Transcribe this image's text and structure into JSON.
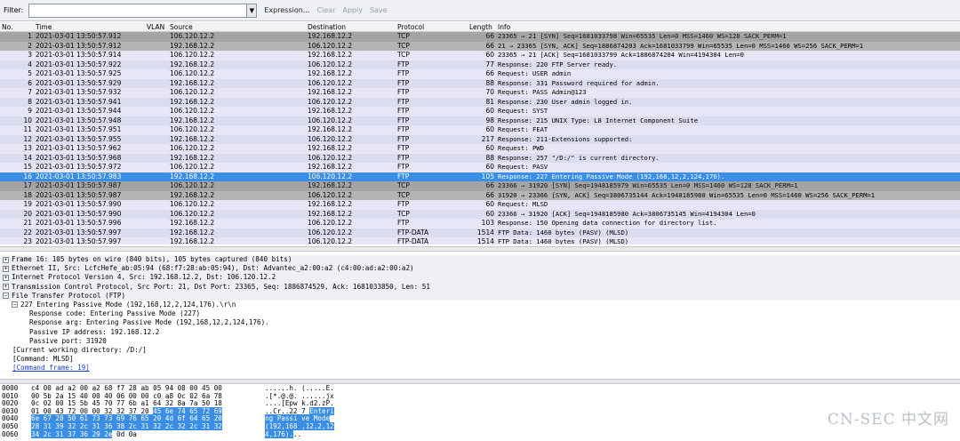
{
  "filter_bar": {
    "label": "Filter:",
    "value": "",
    "expression": "Expression...",
    "clear": "Clear",
    "apply": "Apply",
    "save": "Save"
  },
  "packet_list": {
    "columns": [
      "No.",
      "Time",
      "VLAN",
      "Source",
      "Destination",
      "Protocol",
      "Length",
      "Info"
    ],
    "rows": [
      {
        "no": "1",
        "time": "2021-03-01 13:50:57.912",
        "src": "106.120.12.2",
        "dst": "192.168.12.2",
        "proto": "TCP",
        "len": "66",
        "info": "23365 → 21 [SYN] Seq=1681033798 Win=65535 Len=0 MSS=1460 WS=128 SACK_PERM=1",
        "style": "tcp"
      },
      {
        "no": "2",
        "time": "2021-03-01 13:50:57.912",
        "src": "192.168.12.2",
        "dst": "106.120.12.2",
        "proto": "TCP",
        "len": "66",
        "info": "21 → 23365 [SYN, ACK] Seq=1886874203 Ack=1681033799 Win=65535 Len=0 MSS=1460 WS=256 SACK_PERM=1",
        "style": "tcp"
      },
      {
        "no": "3",
        "time": "2021-03-01 13:50:57.914",
        "src": "106.120.12.2",
        "dst": "192.168.12.2",
        "proto": "TCP",
        "len": "60",
        "info": "23365 → 21 [ACK] Seq=1681033799 Ack=1886874204 Win=4194304 Len=0",
        "style": "ftp"
      },
      {
        "no": "4",
        "time": "2021-03-01 13:50:57.922",
        "src": "192.168.12.2",
        "dst": "106.120.12.2",
        "proto": "FTP",
        "len": "77",
        "info": "Response: 220 FTP Server ready.",
        "style": "ftp"
      },
      {
        "no": "5",
        "time": "2021-03-01 13:50:57.925",
        "src": "106.120.12.2",
        "dst": "192.168.12.2",
        "proto": "FTP",
        "len": "66",
        "info": "Request: USER admin",
        "style": "ftp"
      },
      {
        "no": "6",
        "time": "2021-03-01 13:50:57.929",
        "src": "192.168.12.2",
        "dst": "106.120.12.2",
        "proto": "FTP",
        "len": "88",
        "info": "Response: 331 Password required for admin.",
        "style": "ftp"
      },
      {
        "no": "7",
        "time": "2021-03-01 13:50:57.932",
        "src": "106.120.12.2",
        "dst": "192.168.12.2",
        "proto": "FTP",
        "len": "70",
        "info": "Request: PASS Admin@123",
        "style": "ftp"
      },
      {
        "no": "8",
        "time": "2021-03-01 13:50:57.941",
        "src": "192.168.12.2",
        "dst": "106.120.12.2",
        "proto": "FTP",
        "len": "81",
        "info": "Response: 230 User admin logged in.",
        "style": "ftp"
      },
      {
        "no": "9",
        "time": "2021-03-01 13:50:57.944",
        "src": "106.120.12.2",
        "dst": "192.168.12.2",
        "proto": "FTP",
        "len": "60",
        "info": "Request: SYST",
        "style": "ftp"
      },
      {
        "no": "10",
        "time": "2021-03-01 13:50:57.948",
        "src": "192.168.12.2",
        "dst": "106.120.12.2",
        "proto": "FTP",
        "len": "98",
        "info": "Response: 215 UNIX Type: L8 Internet Component Suite",
        "style": "ftp"
      },
      {
        "no": "11",
        "time": "2021-03-01 13:50:57.951",
        "src": "106.120.12.2",
        "dst": "192.168.12.2",
        "proto": "FTP",
        "len": "60",
        "info": "Request: FEAT",
        "style": "ftp"
      },
      {
        "no": "12",
        "time": "2021-03-01 13:50:57.955",
        "src": "192.168.12.2",
        "dst": "106.120.12.2",
        "proto": "FTP",
        "len": "217",
        "info": "Response: 211-Extensions supported:",
        "style": "ftp"
      },
      {
        "no": "13",
        "time": "2021-03-01 13:50:57.962",
        "src": "106.120.12.2",
        "dst": "192.168.12.2",
        "proto": "FTP",
        "len": "60",
        "info": "Request: PWD",
        "style": "ftp"
      },
      {
        "no": "14",
        "time": "2021-03-01 13:50:57.968",
        "src": "192.168.12.2",
        "dst": "106.120.12.2",
        "proto": "FTP",
        "len": "88",
        "info": "Response: 257 \"/D:/\" is current directory.",
        "style": "ftp"
      },
      {
        "no": "15",
        "time": "2021-03-01 13:50:57.972",
        "src": "106.120.12.2",
        "dst": "192.168.12.2",
        "proto": "FTP",
        "len": "60",
        "info": "Request: PASV",
        "style": "ftp"
      },
      {
        "no": "16",
        "time": "2021-03-01 13:50:57.983",
        "src": "192.168.12.2",
        "dst": "106.120.12.2",
        "proto": "FTP",
        "len": "105",
        "info": "Response: 227 Entering Passive Mode (192,168,12,2,124,176).",
        "style": "sel"
      },
      {
        "no": "17",
        "time": "2021-03-01 13:50:57.987",
        "src": "106.120.12.2",
        "dst": "192.168.12.2",
        "proto": "TCP",
        "len": "66",
        "info": "23366 → 31920 [SYN] Seq=1948185979 Win=65535 Len=0 MSS=1460 WS=128 SACK_PERM=1",
        "style": "tcp"
      },
      {
        "no": "18",
        "time": "2021-03-01 13:50:57.987",
        "src": "192.168.12.2",
        "dst": "106.120.12.2",
        "proto": "TCP",
        "len": "66",
        "info": "31920 → 23366 [SYN, ACK] Seq=3806735144 Ack=1948185980 Win=65535 Len=0 MSS=1460 WS=256 SACK_PERM=1",
        "style": "tcp"
      },
      {
        "no": "19",
        "time": "2021-03-01 13:50:57.990",
        "src": "106.120.12.2",
        "dst": "192.168.12.2",
        "proto": "FTP",
        "len": "60",
        "info": "Request: MLSD",
        "style": "ftp"
      },
      {
        "no": "20",
        "time": "2021-03-01 13:50:57.990",
        "src": "106.120.12.2",
        "dst": "192.168.12.2",
        "proto": "TCP",
        "len": "60",
        "info": "23366 → 31920 [ACK] Seq=1948185980 Ack=3806735145 Win=4194304 Len=0",
        "style": "ftp"
      },
      {
        "no": "21",
        "time": "2021-03-01 13:50:57.996",
        "src": "192.168.12.2",
        "dst": "106.120.12.2",
        "proto": "FTP",
        "len": "103",
        "info": "Response: 150 Opening data connection for directory list.",
        "style": "ftp"
      },
      {
        "no": "22",
        "time": "2021-03-01 13:50:57.997",
        "src": "192.168.12.2",
        "dst": "106.120.12.2",
        "proto": "FTP-DATA",
        "len": "1514",
        "info": "FTP Data: 1460 bytes (PASV) (MLSD)",
        "style": "ftp"
      },
      {
        "no": "23",
        "time": "2021-03-01 13:50:57.997",
        "src": "192.168.12.2",
        "dst": "106.120.12.2",
        "proto": "FTP-DATA",
        "len": "1514",
        "info": "FTP Data: 1460 bytes (PASV) (MLSD)",
        "style": "ftp"
      }
    ]
  },
  "details": {
    "rows": [
      {
        "indent": 0,
        "toggle": "+",
        "text": "Frame 16: 105 bytes on wire (840 bits), 105 bytes captured (840 bits)",
        "section": true
      },
      {
        "indent": 0,
        "toggle": "+",
        "text": "Ethernet II, Src: LcfcHefe_ab:05:94 (68:f7:28:ab:05:94), Dst: Advantec_a2:00:a2 (c4:00:ad:a2:00:a2)",
        "section": true
      },
      {
        "indent": 0,
        "toggle": "+",
        "text": "Internet Protocol Version 4, Src: 192.168.12.2, Dst: 106.120.12.2",
        "section": true
      },
      {
        "indent": 0,
        "toggle": "+",
        "text": "Transmission Control Protocol, Src Port: 21, Dst Port: 23365, Seq: 1886874529, Ack: 1681033850, Len: 51",
        "section": true
      },
      {
        "indent": 0,
        "toggle": "−",
        "text": "File Transfer Protocol (FTP)",
        "section": true
      },
      {
        "indent": 1,
        "toggle": "−",
        "text": "227 Entering Passive Mode (192,168,12,2,124,176).\\r\\n",
        "section": false
      },
      {
        "indent": 2,
        "toggle": "",
        "text": "Response code: Entering Passive Mode (227)",
        "section": false
      },
      {
        "indent": 2,
        "toggle": "",
        "text": "Response arg: Entering Passive Mode (192,168,12,2,124,176).",
        "section": false
      },
      {
        "indent": 2,
        "toggle": "",
        "text": "Passive IP address: 192.168.12.2",
        "section": false
      },
      {
        "indent": 2,
        "toggle": "",
        "text": "Passive port: 31920",
        "section": false
      },
      {
        "indent": 0,
        "toggle": "",
        "text": "[Current working directory: /D:/]",
        "section": false
      },
      {
        "indent": 0,
        "toggle": "",
        "text": "[Command: MLSD]",
        "section": false
      },
      {
        "indent": 0,
        "toggle": "",
        "text": "[Command frame: 19]",
        "section": false,
        "link": true
      }
    ]
  },
  "bytes": {
    "rows": [
      {
        "off": "0000",
        "hex": "c4 00 ad a2 00 a2 68 f7  28 ab 05 94 08 00 45 00",
        "asc": "......h. (.....E.",
        "hl_from": -1
      },
      {
        "off": "0010",
        "hex": "00 5b 2a 15 40 00 40 06  00 00 c0 a8 0c 02 6a 78",
        "asc": ".[*.@.@. ......jx",
        "hl_from": -1
      },
      {
        "off": "0020",
        "hex": "0c 02 00 15 5b 45 70 77  6b a1 64 32 8a 7a 50 18",
        "asc": "....[Epw k.d2.zP.",
        "hl_from": -1
      },
      {
        "off": "0030",
        "hex_plain": "01 00 43 72 00 00 32 32  37 20 ",
        "hex_hl": "45 6e 74 65 72 69",
        "asc_plain": "..Cr..22 7 ",
        "asc_hl": "Enteri"
      },
      {
        "off": "0040",
        "hex_plain": "",
        "hex_hl": "6e 67 20 50 61 73 73 69  76 65 20 4d 6f 64 65 20",
        "asc_plain": "",
        "asc_hl": "ng Passi ve Mode "
      },
      {
        "off": "0050",
        "hex_plain": "",
        "hex_hl": "28 31 39 32 2c 31 36 38  2c 31 32 2c 32 2c 31 32",
        "asc_plain": "",
        "asc_hl": "(192,168 ,12,2,12"
      },
      {
        "off": "0060",
        "hex_plain": "",
        "hex_hl": "34 2c 31 37 36 29 2e",
        "hex_tail": " 0d 0a",
        "asc_plain": "",
        "asc_hl": "4,176).",
        "asc_tail": ".."
      }
    ]
  },
  "watermark": "CN-SEC 中文网"
}
